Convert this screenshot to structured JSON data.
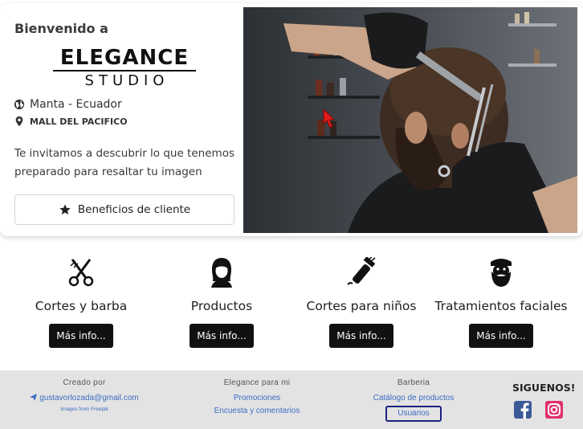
{
  "hero": {
    "welcome": "Bienvenido a",
    "logo_top": "ELEGANCE",
    "logo_bottom": "STUDIO",
    "city": "Manta - Ecuador",
    "mall": "MALL DEL PACIFICO",
    "invite": "Te invitamos a descubrir lo que tenemos preparado para resaltar tu imagen",
    "benefits_label": "Beneficios de cliente"
  },
  "services": [
    {
      "title": "Cortes y barba",
      "button": "Más info...",
      "icon": "scissors-icon"
    },
    {
      "title": "Productos",
      "button": "Más info...",
      "icon": "woman-icon"
    },
    {
      "title": "Cortes para niños",
      "button": "Más info...",
      "icon": "hair-clipper-icon"
    },
    {
      "title": "Tratamientos faciales",
      "button": "Más info...",
      "icon": "bearded-man-icon"
    }
  ],
  "footer": {
    "col1": {
      "heading": "Creado por",
      "email": "gustavorlozada@gmail.com",
      "credit": "Images from Freepik"
    },
    "col2": {
      "heading": "Elegance para mi",
      "links": [
        "Promociones",
        "Encuesta y comentarios"
      ]
    },
    "col3": {
      "heading": "Barberia",
      "catalog": "Catálogo de productos",
      "users": "Usuarios"
    },
    "follow": "SIGUENOS!"
  },
  "colors": {
    "link": "#3d6cc5",
    "button_dark": "#111111",
    "footer_bg": "#e3e3e3",
    "facebook": "#3b5998",
    "instagram": "#e1306c"
  }
}
